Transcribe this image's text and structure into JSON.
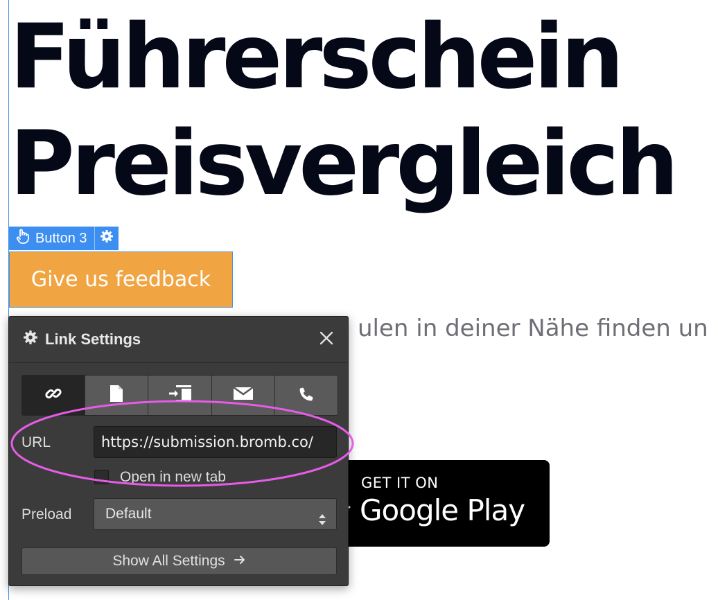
{
  "page": {
    "title_line1": "Führerschein",
    "title_line2": "Preisvergleich",
    "subtitle_fragment": "ulen in deiner Nähe finden un"
  },
  "selection_tag": {
    "element_label": "Button 3",
    "hand_icon": "hand-pointer-icon",
    "settings_icon": "gear-icon"
  },
  "feedback_button": {
    "label": "Give us feedback"
  },
  "google_play": {
    "line1": "GET IT ON",
    "line2": "Google Play"
  },
  "link_settings": {
    "title": "Link Settings",
    "title_icon": "gear-icon",
    "close_icon": "close-icon",
    "tabs": [
      {
        "icon": "link-icon",
        "active": true
      },
      {
        "icon": "page-icon",
        "active": false
      },
      {
        "icon": "section-anchor-icon",
        "active": false
      },
      {
        "icon": "email-icon",
        "active": false
      },
      {
        "icon": "phone-icon",
        "active": false
      }
    ],
    "url_label": "URL",
    "url_value": "https://submission.bromb.co/",
    "open_new_tab_label": "Open in new tab",
    "open_new_tab_checked": false,
    "preload_label": "Preload",
    "preload_value": "Default",
    "show_all_label": "Show All Settings"
  },
  "colors": {
    "accent_blue": "#3c8ff0",
    "button_orange": "#f0a442",
    "panel_bg": "#3b3b3b",
    "annotation_magenta": "#e65ce6"
  }
}
